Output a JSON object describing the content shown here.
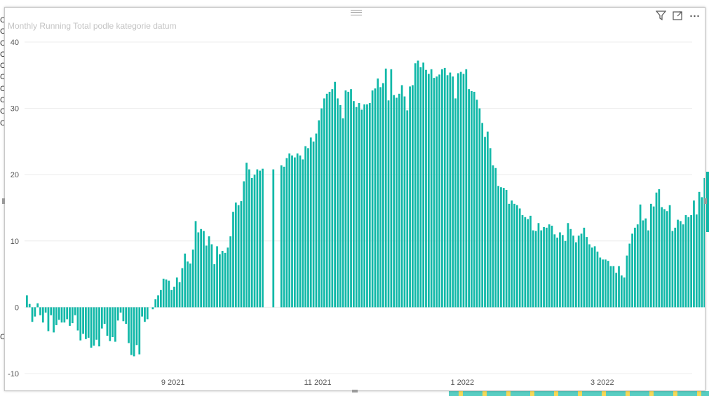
{
  "visual": {
    "title": "Monthly Running Total podle kategorie datum",
    "icons": [
      "filter-icon",
      "focus-mode-icon",
      "more-options-icon"
    ]
  },
  "background": {
    "left_column_letters": [
      "C",
      "C",
      "C",
      "C",
      "C",
      "C",
      "C",
      "C",
      "C",
      "C",
      "C"
    ]
  },
  "chart_data": {
    "type": "bar",
    "title": "Monthly Running Total podle kategorie datum",
    "xlabel": "",
    "ylabel": "",
    "ylim": [
      -10,
      40
    ],
    "yticks": [
      -10,
      0,
      10,
      20,
      30,
      40
    ],
    "ytick_labels": [
      "-10",
      "0",
      "10",
      "20",
      "30",
      "40"
    ],
    "xticks": [
      {
        "label": "9 2021",
        "date": "2021-09-01"
      },
      {
        "label": "11 2021",
        "date": "2021-11-01"
      },
      {
        "label": "1 2022",
        "date": "2022-01-01"
      },
      {
        "label": "3 2022",
        "date": "2022-03-01"
      }
    ],
    "x_start": "2021-07-01",
    "x_end": "2022-04-15",
    "grid": "horizontal",
    "legend": "none",
    "bar_color": "#11b8a8",
    "values": [
      1.8,
      0.5,
      -2.2,
      -1.4,
      0.6,
      -1.2,
      -2.3,
      -0.8,
      -3.6,
      -1.2,
      -3.8,
      -2.7,
      -1.9,
      -2.3,
      -2.3,
      -1.8,
      -2.8,
      -2.4,
      -1.2,
      -3.5,
      -5.0,
      -4.0,
      -4.8,
      -4.6,
      -6.1,
      -5.8,
      -4.9,
      -5.9,
      -3.2,
      -2.5,
      -4.3,
      -5.1,
      -4.5,
      -5.2,
      -2.0,
      -0.8,
      -2.1,
      -2.5,
      -5.4,
      -7.2,
      -7.4,
      -5.7,
      -7.1,
      -1.4,
      -2.2,
      -1.8,
      null,
      -0.3,
      1.2,
      1.8,
      2.6,
      4.3,
      4.2,
      4.0,
      2.6,
      3.1,
      4.5,
      3.8,
      5.9,
      8.1,
      6.9,
      6.6,
      8.7,
      13.0,
      11.3,
      11.8,
      11.5,
      9.3,
      10.7,
      9.5,
      6.5,
      9.2,
      8.0,
      8.5,
      8.2,
      9.0,
      10.7,
      14.4,
      15.8,
      15.4,
      16.0,
      19.0,
      21.8,
      20.8,
      19.5,
      20.0,
      20.8,
      20.6,
      20.9,
      null,
      null,
      null,
      20.8,
      null,
      null,
      21.4,
      21.2,
      22.5,
      23.2,
      22.9,
      22.6,
      23.2,
      22.9,
      22.3,
      24.3,
      24.0,
      25.6,
      25.0,
      26.2,
      28.2,
      30.0,
      31.5,
      32.2,
      32.5,
      32.9,
      34.0,
      31.5,
      30.5,
      28.5,
      32.7,
      32.5,
      32.9,
      31.1,
      30.2,
      30.8,
      29.8,
      30.6,
      30.6,
      30.8,
      32.7,
      33.0,
      34.5,
      33.2,
      33.8,
      36.0,
      31.2,
      35.9,
      32.0,
      31.6,
      32.2,
      33.5,
      31.8,
      29.7,
      33.3,
      33.5,
      36.8,
      37.2,
      36.2,
      36.9,
      35.8,
      35.2,
      35.9,
      34.6,
      34.8,
      35.1,
      35.9,
      36.1,
      35.0,
      35.4,
      34.8,
      31.5,
      35.3,
      35.5,
      35.2,
      35.9,
      32.9,
      32.6,
      32.5,
      31.3,
      30.0,
      27.8,
      25.7,
      26.5,
      24.0,
      21.4,
      21.0,
      18.3,
      18.1,
      18.0,
      17.7,
      15.6,
      16.1,
      15.6,
      15.4,
      14.9,
      13.9,
      13.6,
      13.3,
      13.8,
      11.6,
      11.5,
      12.7,
      11.6,
      12.1,
      12.0,
      12.5,
      12.3,
      11.0,
      10.5,
      11.3,
      10.9,
      10.0,
      12.7,
      11.8,
      10.8,
      9.8,
      10.8,
      11.1,
      12.0,
      10.6,
      9.5,
      9.0,
      9.2,
      8.4,
      7.5,
      7.2,
      7.2,
      7.0,
      6.2,
      6.2,
      5.2,
      6.2,
      4.8,
      4.5,
      7.8,
      9.6,
      11.1,
      12.0,
      12.5,
      15.5,
      13.1,
      13.4,
      11.6,
      15.6,
      15.2,
      17.3,
      17.8,
      15.1,
      14.8,
      14.5,
      15.4,
      11.5,
      12.0,
      13.2,
      13.0,
      12.5,
      13.9,
      13.6,
      13.9,
      16.1,
      14.0,
      17.4,
      16.6,
      19.5,
      13.9
    ]
  }
}
